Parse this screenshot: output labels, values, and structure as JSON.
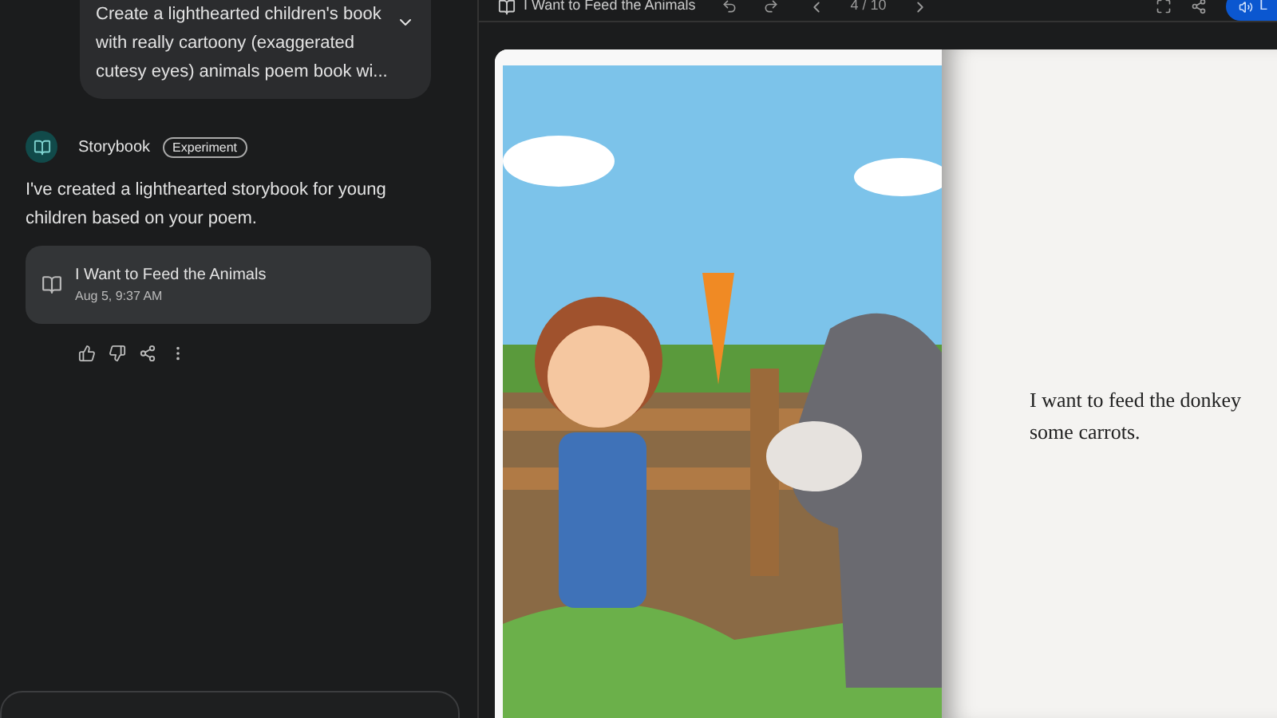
{
  "prompt": {
    "lines": [
      "Create a lighthearted children's book",
      "with really cartoony (exaggerated",
      "cutesy eyes) animals poem book wi..."
    ]
  },
  "response": {
    "agent": "Storybook",
    "badge": "Experiment",
    "message": "I've created a lighthearted storybook for young children based on your poem.",
    "card": {
      "title": "I Want to Feed the Animals",
      "time": "Aug 5, 9:37 AM"
    }
  },
  "viewer": {
    "title": "I Want to Feed the Animals",
    "page": "4 / 10",
    "listen_label": "L"
  },
  "book": {
    "text": "I want to feed the donkey some carrots."
  }
}
